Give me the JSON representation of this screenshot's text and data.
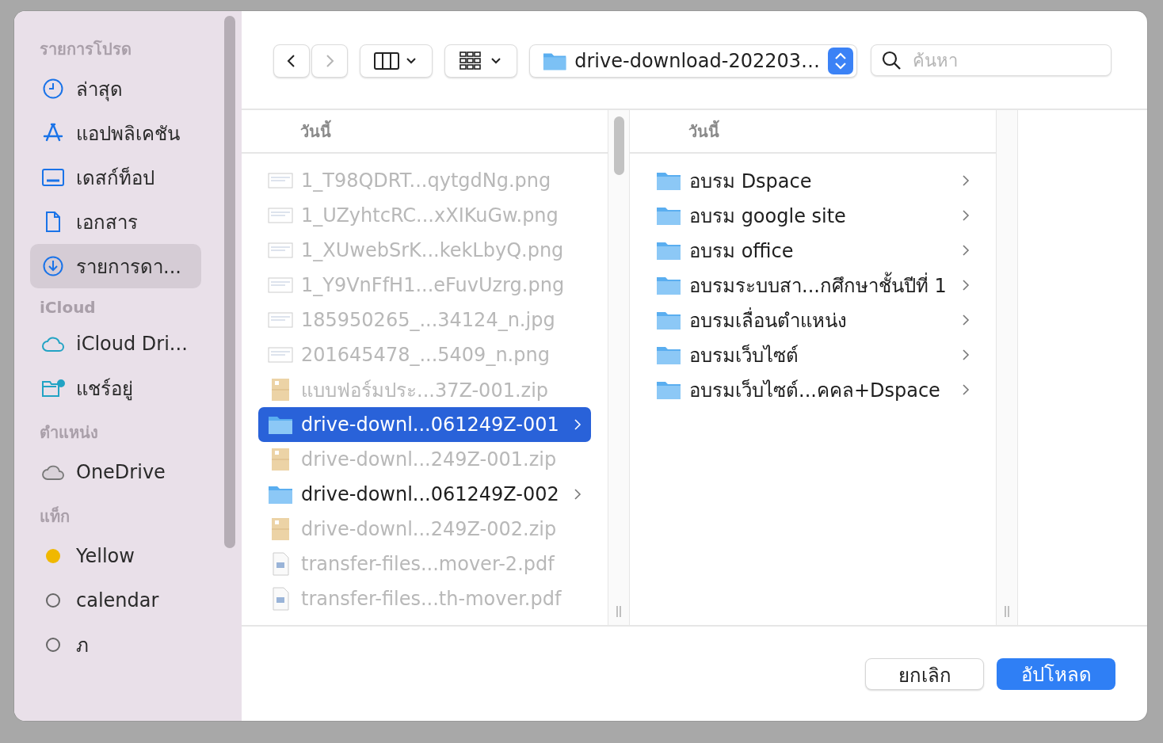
{
  "sidebar": {
    "sections": [
      {
        "title": "รายการโปรด",
        "items": [
          {
            "label": "ล่าสุด",
            "kind": "clock",
            "selected": false
          },
          {
            "label": "แอปพลิเคชัน",
            "kind": "apps",
            "selected": false
          },
          {
            "label": "เดสก์ท็อป",
            "kind": "desktop",
            "selected": false
          },
          {
            "label": "เอกสาร",
            "kind": "document",
            "selected": false
          },
          {
            "label": "รายการดา...",
            "kind": "download",
            "selected": true
          }
        ]
      },
      {
        "title": "iCloud",
        "items": [
          {
            "label": "iCloud Dri...",
            "kind": "cloud",
            "selected": false
          },
          {
            "label": "แชร์อยู่",
            "kind": "shared",
            "selected": false
          }
        ]
      },
      {
        "title": "ตำแหน่ง",
        "items": [
          {
            "label": "OneDrive",
            "kind": "drive",
            "selected": false
          }
        ]
      },
      {
        "title": "แท็ก",
        "items": [
          {
            "label": "Yellow",
            "kind": "tag",
            "color": "#f0b800",
            "selected": false
          },
          {
            "label": "calendar",
            "kind": "tag",
            "selected": false
          },
          {
            "label": "ภ",
            "kind": "tag",
            "selected": false
          }
        ]
      }
    ]
  },
  "toolbar": {
    "back": {
      "disabled": false
    },
    "forward": {
      "disabled": true
    },
    "path": "drive-download-202203…",
    "search": {
      "placeholder": "ค้นหา"
    }
  },
  "columns": [
    {
      "header": "วันนี้",
      "items": [
        {
          "name": "1_T98QDRT...qytgdNg.png",
          "kind": "image",
          "disabled": true,
          "selected": false
        },
        {
          "name": "1_UZyhtcRC...xXIKuGw.png",
          "kind": "image",
          "disabled": true,
          "selected": false
        },
        {
          "name": "1_XUwebSrK...kekLbyQ.png",
          "kind": "image",
          "disabled": true,
          "selected": false
        },
        {
          "name": "1_Y9VnFfH1...eFuvUzrg.png",
          "kind": "image",
          "disabled": true,
          "selected": false
        },
        {
          "name": "185950265_...34124_n.jpg",
          "kind": "image",
          "disabled": true,
          "selected": false
        },
        {
          "name": "201645478_...5409_n.png",
          "kind": "image",
          "disabled": true,
          "selected": false
        },
        {
          "name": "แบบฟอร์มประ...37Z-001.zip",
          "kind": "zip",
          "disabled": true,
          "selected": false
        },
        {
          "name": "drive-downl...061249Z-001",
          "kind": "folder",
          "disabled": false,
          "selected": true
        },
        {
          "name": "drive-downl...249Z-001.zip",
          "kind": "zip",
          "disabled": true,
          "selected": false
        },
        {
          "name": "drive-downl...061249Z-002",
          "kind": "folder",
          "disabled": false,
          "selected": false
        },
        {
          "name": "drive-downl...249Z-002.zip",
          "kind": "zip",
          "disabled": true,
          "selected": false
        },
        {
          "name": "transfer-files...mover-2.pdf",
          "kind": "pdf",
          "disabled": true,
          "selected": false
        },
        {
          "name": "transfer-files...th-mover.pdf",
          "kind": "pdf",
          "disabled": true,
          "selected": false
        }
      ]
    },
    {
      "header": "วันนี้",
      "items": [
        {
          "name": "อบรม Dspace",
          "kind": "folder",
          "disabled": false,
          "selected": false
        },
        {
          "name": "อบรม google site",
          "kind": "folder",
          "disabled": false,
          "selected": false
        },
        {
          "name": "อบรม office",
          "kind": "folder",
          "disabled": false,
          "selected": false
        },
        {
          "name": "อบรมระบบสา...กศึกษาชั้นปีที่ 1",
          "kind": "folder",
          "disabled": false,
          "selected": false
        },
        {
          "name": "อบรมเลื่อนตำแหน่ง",
          "kind": "folder",
          "disabled": false,
          "selected": false
        },
        {
          "name": "อบรมเว็บไซต์",
          "kind": "folder",
          "disabled": false,
          "selected": false
        },
        {
          "name": "อบรมเว็บไซต์...คคล+Dspace",
          "kind": "folder",
          "disabled": false,
          "selected": false
        }
      ]
    }
  ],
  "buttons": [
    {
      "label": "ยกเลิก",
      "kind": "secondary"
    },
    {
      "label": "อัปโหลด",
      "kind": "primary"
    }
  ]
}
